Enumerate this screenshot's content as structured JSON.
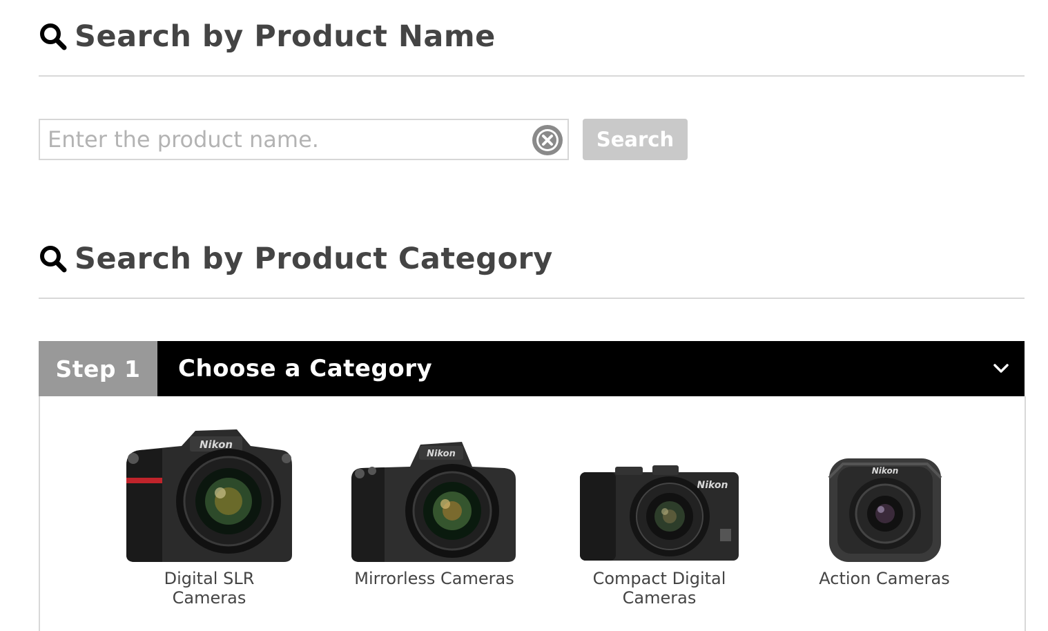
{
  "search_by_name": {
    "heading": "Search by Product Name",
    "input_placeholder": "Enter the product name.",
    "input_value": "",
    "search_button_label": "Search"
  },
  "search_by_category": {
    "heading": "Search by Product Category",
    "step": {
      "tag": "Step 1",
      "title": "Choose a Category"
    },
    "categories": [
      {
        "label": "Digital SLR Cameras",
        "icon": "dslr-camera-icon"
      },
      {
        "label": "Mirrorless Cameras",
        "icon": "mirrorless-camera-icon"
      },
      {
        "label": "Compact Digital Cameras",
        "icon": "compact-camera-icon"
      },
      {
        "label": "Action Cameras",
        "icon": "action-camera-icon"
      }
    ]
  },
  "brand_text": "Nikon",
  "colors": {
    "heading_text": "#444444",
    "step_bar": "#000000",
    "step_tag": "#999999",
    "search_button": "#c9c9c9"
  }
}
